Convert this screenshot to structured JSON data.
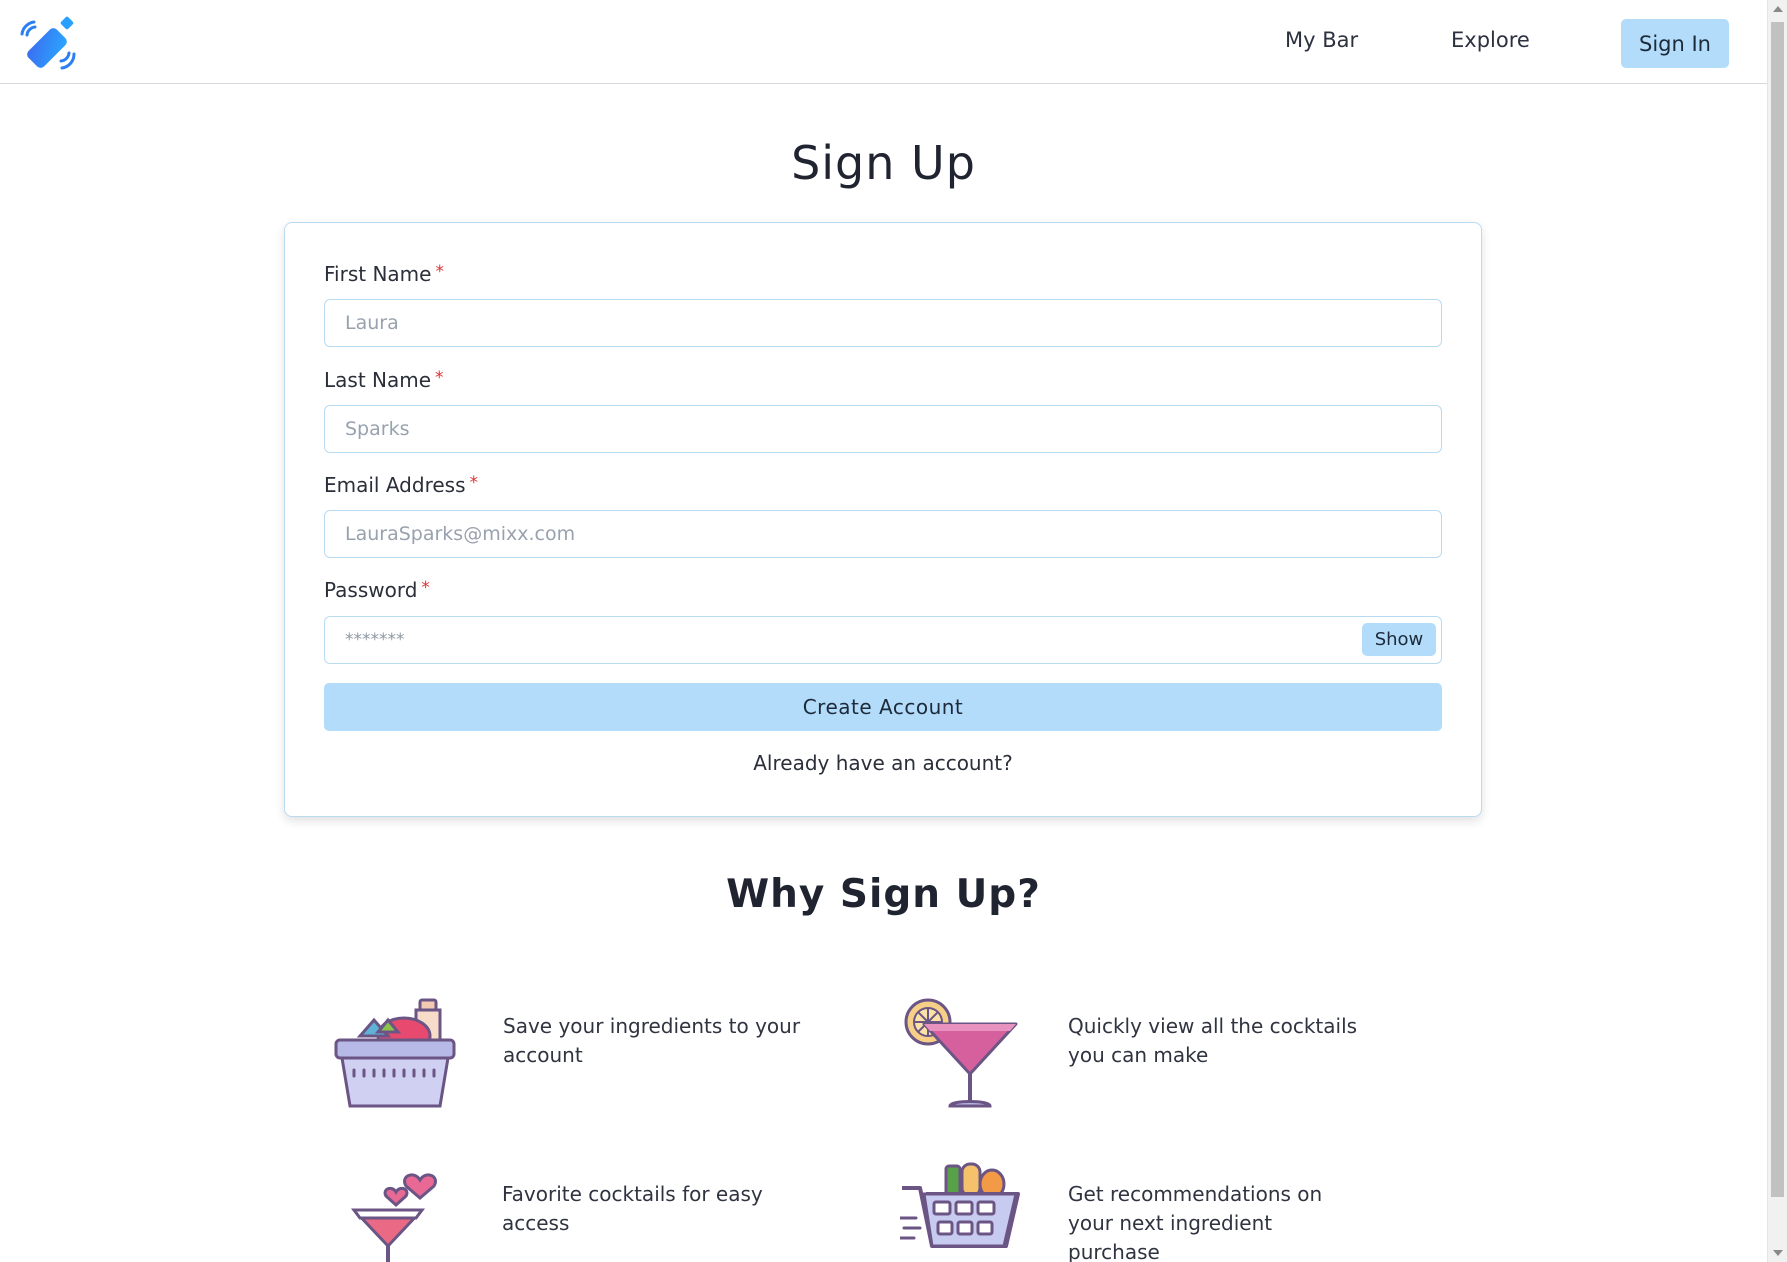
{
  "header": {
    "nav": {
      "my_bar": "My Bar",
      "explore": "Explore",
      "sign_in": "Sign In"
    }
  },
  "signup": {
    "title": "Sign Up",
    "fields": {
      "first_name": {
        "label": "First Name",
        "placeholder": "Laura",
        "value": ""
      },
      "last_name": {
        "label": "Last Name",
        "placeholder": "Sparks",
        "value": ""
      },
      "email": {
        "label": "Email Address",
        "placeholder": "LauraSparks@mixx.com",
        "value": ""
      },
      "password": {
        "label": "Password",
        "placeholder": "*******",
        "value": ""
      }
    },
    "required_mark": "*",
    "show_label": "Show",
    "create_account_label": "Create Account",
    "already_account_label": "Already have an account?"
  },
  "why": {
    "title": "Why Sign Up?",
    "benefits": [
      {
        "icon": "grocery-basket-icon",
        "text": "Save your ingredients to your account"
      },
      {
        "icon": "cocktail-glass-icon",
        "text": "Quickly view all the cocktails you can make"
      },
      {
        "icon": "favorite-cocktail-icon",
        "text": "Favorite cocktails for easy access"
      },
      {
        "icon": "shopping-cart-icon",
        "text": "Get recommendations on your next ingredient purchase"
      }
    ]
  },
  "colors": {
    "accent": "#b3dcfa",
    "border": "#b9dbf2",
    "required": "#dd3333"
  }
}
